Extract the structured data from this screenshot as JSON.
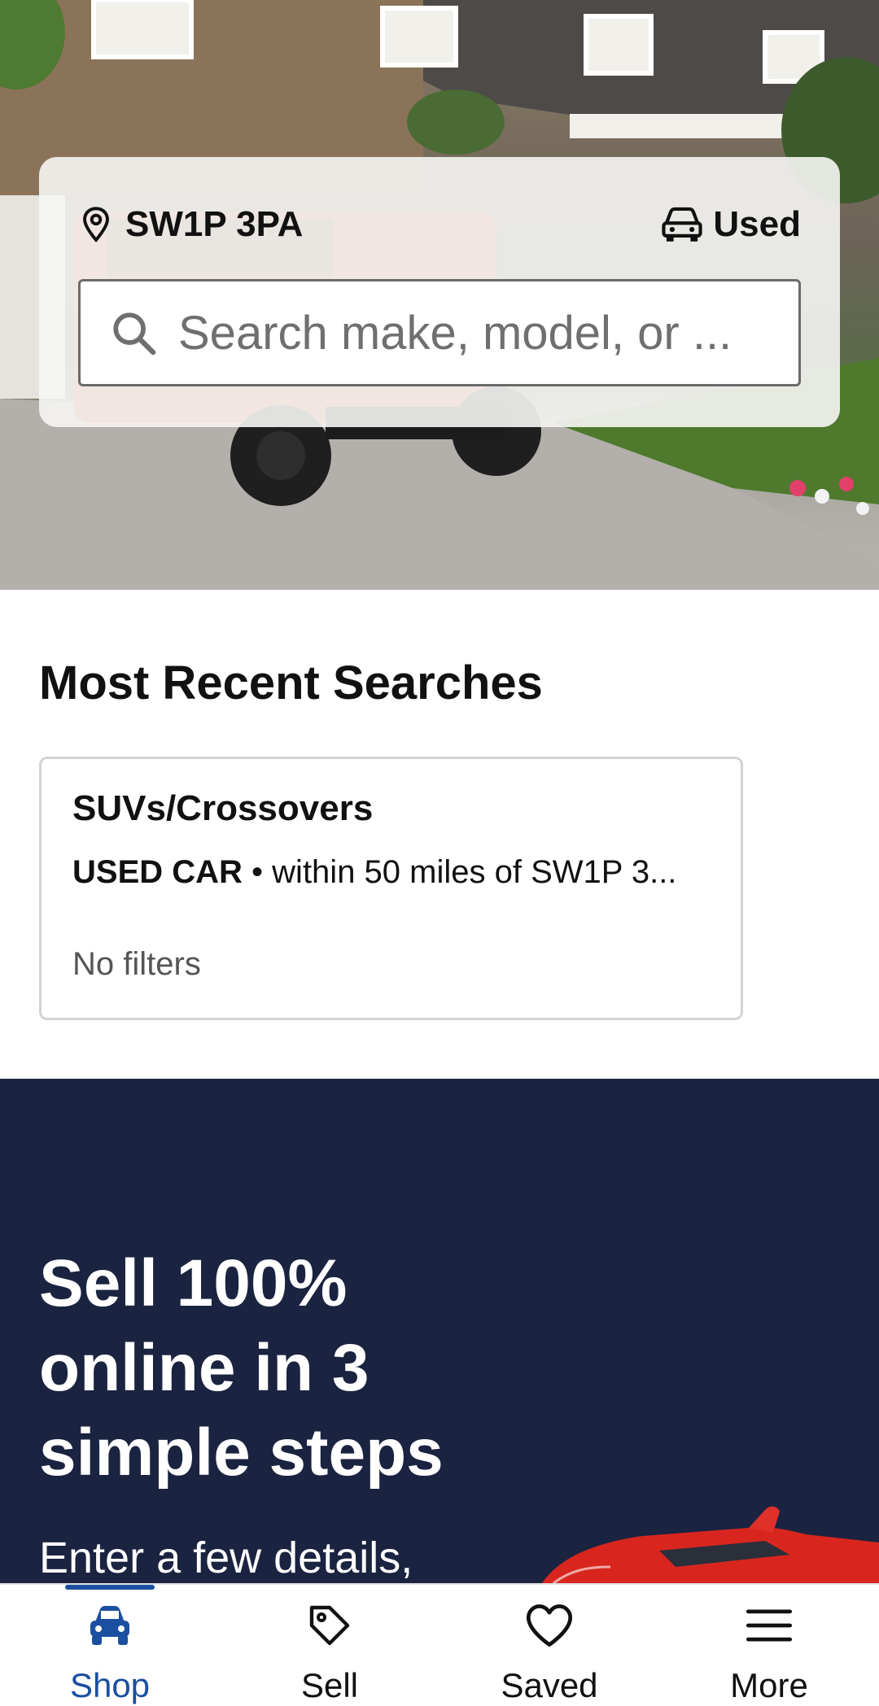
{
  "search": {
    "location": "SW1P 3PA",
    "condition": "Used",
    "placeholder": "Search make, model, or ..."
  },
  "recent": {
    "title": "Most Recent Searches",
    "card": {
      "title": "SUVs/Crossovers",
      "type": "USED CAR",
      "separator": "•",
      "detail": "within 50 miles of SW1P 3...",
      "filters": "No filters"
    }
  },
  "sell_banner": {
    "headline": "Sell 100% online in 3 simple steps",
    "body": "Enter a few details,"
  },
  "nav": {
    "items": [
      {
        "label": "Shop",
        "icon": "car-icon",
        "active": true
      },
      {
        "label": "Sell",
        "icon": "tag-icon",
        "active": false
      },
      {
        "label": "Saved",
        "icon": "heart-icon",
        "active": false
      },
      {
        "label": "More",
        "icon": "menu-icon",
        "active": false
      }
    ]
  },
  "colors": {
    "accent": "#1b4fa0",
    "banner_bg": "#1a2340"
  }
}
